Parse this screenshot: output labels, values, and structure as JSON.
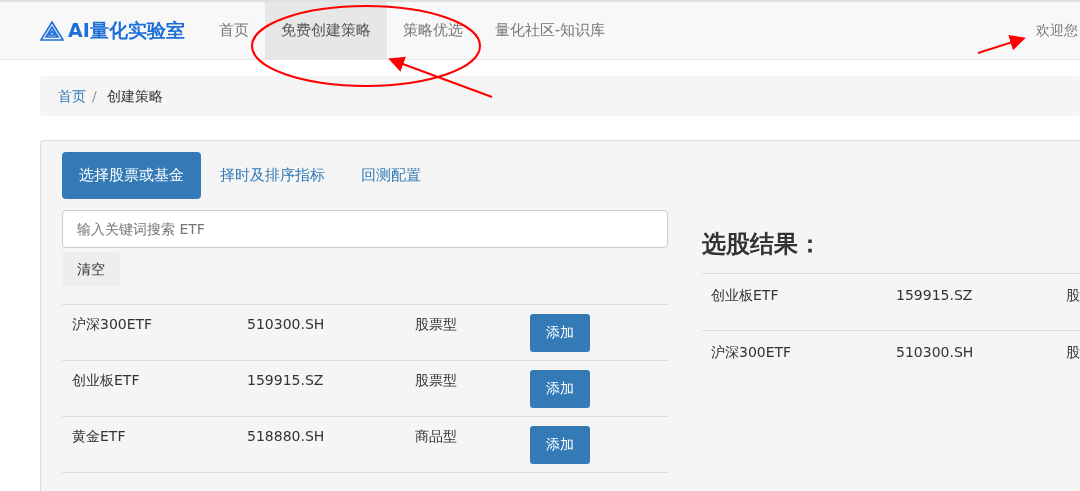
{
  "brand": {
    "text": "AI量化实验室"
  },
  "nav": [
    {
      "label": "首页",
      "selected": false
    },
    {
      "label": "免费创建策略",
      "selected": true
    },
    {
      "label": "策略优选",
      "selected": false
    },
    {
      "label": "量化社区-知识库",
      "selected": false
    }
  ],
  "user": {
    "text": "欢迎您"
  },
  "breadcrumb": [
    {
      "label": "首页",
      "kind": "link"
    },
    {
      "label": "/",
      "kind": "separator"
    },
    {
      "label": "创建策略",
      "kind": "current"
    }
  ],
  "tabs": [
    {
      "label": "选择股票或基金",
      "selected": true
    },
    {
      "label": "择时及排序指标",
      "selected": false
    },
    {
      "label": "回测配置",
      "selected": false
    }
  ],
  "search": {
    "placeholder": "输入关键词搜索 ETF"
  },
  "clear_button": "清空",
  "etf_list": [
    {
      "name": "沪深300ETF",
      "code": "510300.SH",
      "type": "股票型",
      "action": "添加"
    },
    {
      "name": "创业板ETF",
      "code": "159915.SZ",
      "type": "股票型",
      "action": "添加"
    },
    {
      "name": "黄金ETF",
      "code": "518880.SH",
      "type": "商品型",
      "action": "添加"
    }
  ],
  "results": {
    "title": "选股结果：",
    "rows": [
      {
        "name": "创业板ETF",
        "code": "159915.SZ",
        "column_3": "股"
      },
      {
        "name": "沪深300ETF",
        "code": "510300.SH",
        "column_3": "股"
      }
    ]
  }
}
